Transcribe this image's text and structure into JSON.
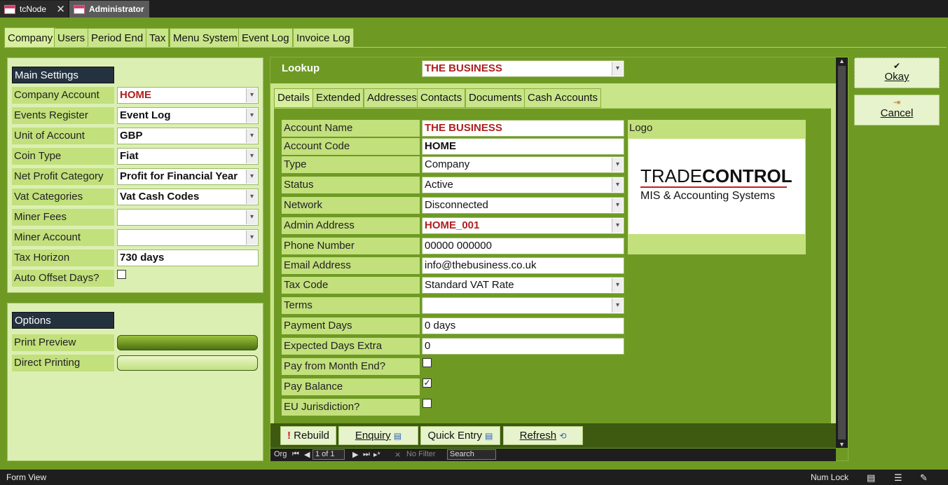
{
  "doc_tabs": [
    {
      "label": "tcNode"
    },
    {
      "label": "Administrator"
    }
  ],
  "form_tabs": [
    "Company",
    "Users",
    "Period End",
    "Tax",
    "Menu System",
    "Event Log",
    "Invoice Log"
  ],
  "main_settings": {
    "header": "Main Settings",
    "rows": [
      {
        "label": "Company Account",
        "value": "HOME"
      },
      {
        "label": "Events Register",
        "value": "Event Log"
      },
      {
        "label": "Unit of Account",
        "value": "GBP"
      },
      {
        "label": "Coin Type",
        "value": "Fiat"
      },
      {
        "label": "Net Profit Category",
        "value": "Profit for Financial Year"
      },
      {
        "label": "Vat Categories",
        "value": "Vat Cash Codes"
      },
      {
        "label": "Miner Fees",
        "value": ""
      },
      {
        "label": "Miner Account",
        "value": ""
      },
      {
        "label": "Tax Horizon",
        "value": "730 days"
      },
      {
        "label": "Auto Offset Days?",
        "value": ""
      }
    ]
  },
  "options": {
    "header": "Options",
    "print_preview": "Print Preview",
    "direct_printing": "Direct Printing"
  },
  "lookup": {
    "label": "Lookup",
    "value": "THE BUSINESS"
  },
  "sub_tabs": [
    "Details",
    "Extended",
    "Addresses",
    "Contacts",
    "Documents",
    "Cash Accounts"
  ],
  "details": [
    {
      "label": "Account Name",
      "value": "THE BUSINESS"
    },
    {
      "label": "Account Code",
      "value": "HOME"
    },
    {
      "label": "Type",
      "value": "Company"
    },
    {
      "label": "Status",
      "value": "Active"
    },
    {
      "label": "Network",
      "value": "Disconnected"
    },
    {
      "label": "Admin Address",
      "value": "HOME_001"
    },
    {
      "label": "Phone Number",
      "value": "00000 000000"
    },
    {
      "label": "Email Address",
      "value": "info@thebusiness.co.uk"
    },
    {
      "label": "Tax Code",
      "value": "Standard VAT Rate"
    },
    {
      "label": "Terms",
      "value": ""
    },
    {
      "label": "Payment Days",
      "value": "0 days"
    },
    {
      "label": "Expected Days Extra",
      "value": "0"
    },
    {
      "label": "Pay from Month End?",
      "value": ""
    },
    {
      "label": "Pay Balance",
      "value": "✓"
    },
    {
      "label": "EU Jurisdiction?",
      "value": ""
    }
  ],
  "logo": {
    "label": "Logo",
    "brand_a": "TRADE",
    "brand_b": "CONTROL",
    "tagline": "MIS & Accounting Systems"
  },
  "buttons": {
    "rebuild": "Rebuild",
    "enquiry": "Enquiry",
    "quick_entry": "Quick Entry",
    "refresh": "Refresh",
    "okay": "Okay",
    "cancel": "Cancel"
  },
  "record_nav": {
    "org": "Org",
    "position": "1 of 1",
    "filter": "No Filter",
    "search": "Search"
  },
  "status_bar": {
    "view": "Form View",
    "numlock": "Num Lock"
  },
  "colors": {
    "accent_green": "#6e9a24",
    "label_green": "#c2e07c",
    "red_text": "#b02020"
  }
}
